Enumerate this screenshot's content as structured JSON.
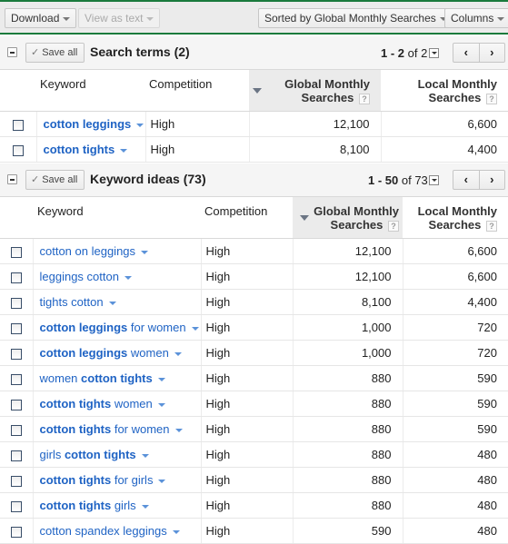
{
  "toolbar": {
    "download_label": "Download",
    "view_as_text_label": "View as text",
    "sorted_by_label": "Sorted by Global Monthly Searches",
    "columns_label": "Columns"
  },
  "search_terms": {
    "save_all_label": "Save all",
    "title": "Search terms (2)",
    "pager": {
      "range": "1 - 2",
      "of": "of 2"
    },
    "columns": {
      "keyword": "Keyword",
      "competition": "Competition",
      "global_line1": "Global Monthly",
      "global_line2": "Searches",
      "local_line1": "Local Monthly",
      "local_line2": "Searches",
      "help": "?"
    },
    "rows": [
      {
        "parts": [
          {
            "t": "cotton leggings",
            "b": true
          }
        ],
        "competition": "High",
        "global": "12,100",
        "local": "6,600"
      },
      {
        "parts": [
          {
            "t": "cotton tights",
            "b": true
          }
        ],
        "competition": "High",
        "global": "8,100",
        "local": "4,400"
      }
    ]
  },
  "keyword_ideas": {
    "save_all_label": "Save all",
    "title": "Keyword ideas (73)",
    "pager": {
      "range": "1 - 50",
      "of": "of 73"
    },
    "columns": {
      "keyword": "Keyword",
      "competition": "Competition",
      "global_line1": "Global Monthly",
      "global_line2": "Searches",
      "local_line1": "Local Monthly",
      "local_line2": "Searches",
      "help": "?"
    },
    "rows": [
      {
        "parts": [
          {
            "t": "cotton on leggings",
            "b": false
          }
        ],
        "competition": "High",
        "global": "12,100",
        "local": "6,600"
      },
      {
        "parts": [
          {
            "t": "leggings cotton",
            "b": false
          }
        ],
        "competition": "High",
        "global": "12,100",
        "local": "6,600"
      },
      {
        "parts": [
          {
            "t": "tights cotton",
            "b": false
          }
        ],
        "competition": "High",
        "global": "8,100",
        "local": "4,400"
      },
      {
        "parts": [
          {
            "t": "cotton leggings",
            "b": true
          },
          {
            "t": " for women",
            "b": false
          }
        ],
        "competition": "High",
        "global": "1,000",
        "local": "720"
      },
      {
        "parts": [
          {
            "t": "cotton leggings",
            "b": true
          },
          {
            "t": " women",
            "b": false
          }
        ],
        "competition": "High",
        "global": "1,000",
        "local": "720"
      },
      {
        "parts": [
          {
            "t": "women ",
            "b": false
          },
          {
            "t": "cotton tights",
            "b": true
          }
        ],
        "competition": "High",
        "global": "880",
        "local": "590"
      },
      {
        "parts": [
          {
            "t": "cotton tights",
            "b": true
          },
          {
            "t": " women",
            "b": false
          }
        ],
        "competition": "High",
        "global": "880",
        "local": "590"
      },
      {
        "parts": [
          {
            "t": "cotton tights",
            "b": true
          },
          {
            "t": " for women",
            "b": false
          }
        ],
        "competition": "High",
        "global": "880",
        "local": "590"
      },
      {
        "parts": [
          {
            "t": "girls ",
            "b": false
          },
          {
            "t": "cotton tights",
            "b": true
          }
        ],
        "competition": "High",
        "global": "880",
        "local": "480"
      },
      {
        "parts": [
          {
            "t": "cotton tights",
            "b": true
          },
          {
            "t": " for girls",
            "b": false
          }
        ],
        "competition": "High",
        "global": "880",
        "local": "480"
      },
      {
        "parts": [
          {
            "t": "cotton tights",
            "b": true
          },
          {
            "t": " girls",
            "b": false
          }
        ],
        "competition": "High",
        "global": "880",
        "local": "480"
      },
      {
        "parts": [
          {
            "t": "cotton spandex leggings",
            "b": false
          }
        ],
        "competition": "High",
        "global": "590",
        "local": "480"
      }
    ]
  },
  "colors": {
    "accent_green": "#1a7a3c",
    "link_blue": "#1f63c4"
  }
}
